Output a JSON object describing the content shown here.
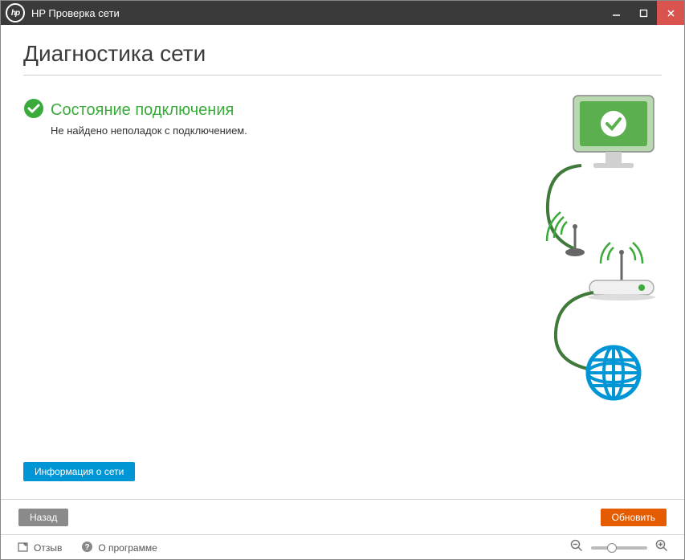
{
  "titlebar": {
    "app_title": "HP Проверка сети"
  },
  "page": {
    "title": "Диагностика сети"
  },
  "status": {
    "heading": "Состояние подключения",
    "message": "Не найдено неполадок с подключением."
  },
  "buttons": {
    "network_info": "Информация о сети",
    "back": "Назад",
    "refresh": "Обновить"
  },
  "footer": {
    "feedback": "Отзыв",
    "about": "О программе"
  },
  "colors": {
    "accent_blue": "#0096d6",
    "status_green": "#3aab3a",
    "action_orange": "#e55b00"
  }
}
